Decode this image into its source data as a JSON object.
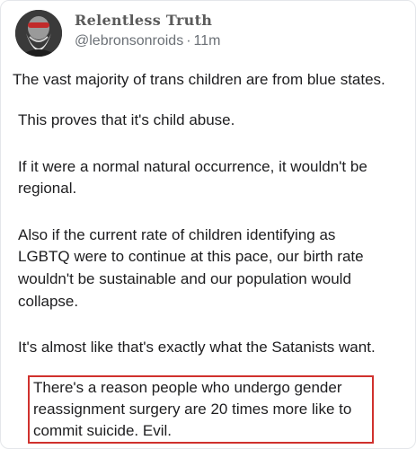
{
  "post": {
    "author": {
      "display_name": "Relentless Truth",
      "handle": "@lebronsonroids",
      "separator": "·",
      "time_ago": "11m",
      "avatar_icon": "bearded-man-avatar"
    },
    "lines": [
      "The vast majority of trans children are from blue states.",
      "This proves that it's child abuse.",
      "If it were a normal natural occurrence, it wouldn't be",
      "regional.",
      "Also if the current rate of children identifying as",
      "LGBTQ were to continue at this pace, our birth rate",
      "wouldn't be sustainable and our population would",
      "collapse.",
      "It's almost like that's exactly what the Satanists want."
    ],
    "highlighted_lines": [
      "There's a reason people who undergo gender",
      "reassignment surgery are 20 times more like to",
      "commit suicide.  Evil."
    ],
    "highlight_color": "#d0312d"
  }
}
